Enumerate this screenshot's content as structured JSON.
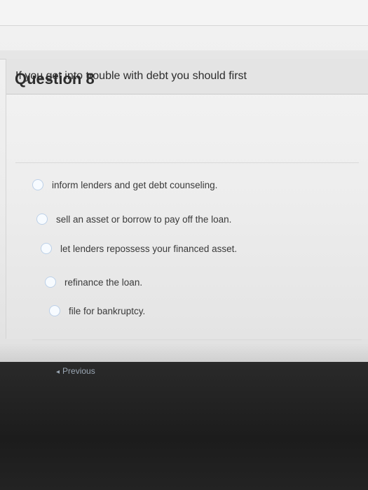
{
  "question": {
    "title": "Question 8",
    "prompt": "If you get into trouble with debt you should first"
  },
  "options": [
    {
      "label": "inform lenders and get debt counseling."
    },
    {
      "label": "sell an asset or borrow to pay off the loan."
    },
    {
      "label": "let lenders repossess your financed asset."
    },
    {
      "label": "refinance the loan."
    },
    {
      "label": "file for bankruptcy."
    }
  ],
  "nav": {
    "previous_label": "Previous",
    "previous_icon": "chevron-left-icon"
  },
  "colors": {
    "radio_border": "#bcd0e8",
    "footer": "#1f1f1f"
  }
}
